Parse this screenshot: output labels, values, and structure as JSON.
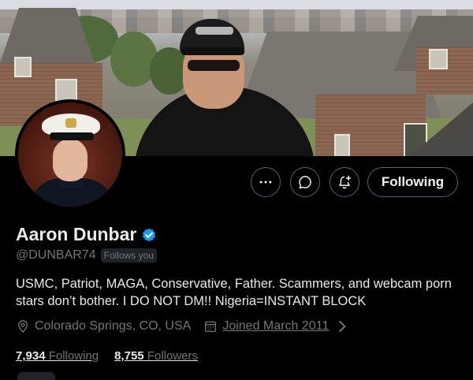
{
  "profile": {
    "display_name": "Aaron Dunbar",
    "handle": "@DUNBAR74",
    "follows_you_badge": "Follows you",
    "bio": "USMC, Patriot, MAGA, Conservative, Father. Scammers, and webcam porn stars don’t bother. I DO NOT DM!! Nigeria=INSTANT BLOCK",
    "location": "Colorado Springs, CO, USA",
    "joined": "Joined March 2011"
  },
  "actions": {
    "more_icon": "more-icon",
    "message_icon": "message-icon",
    "notifications_icon": "bell-plus-icon",
    "follow_label": "Following"
  },
  "stats": {
    "following_count": "7,934",
    "following_label": "Following",
    "followers_count": "8,755",
    "followers_label": "Followers"
  },
  "colors": {
    "background": "#000000",
    "text_primary": "#e7e9ea",
    "text_secondary": "#71767b",
    "verified": "#1d9bf0",
    "button_border": "#536471"
  }
}
